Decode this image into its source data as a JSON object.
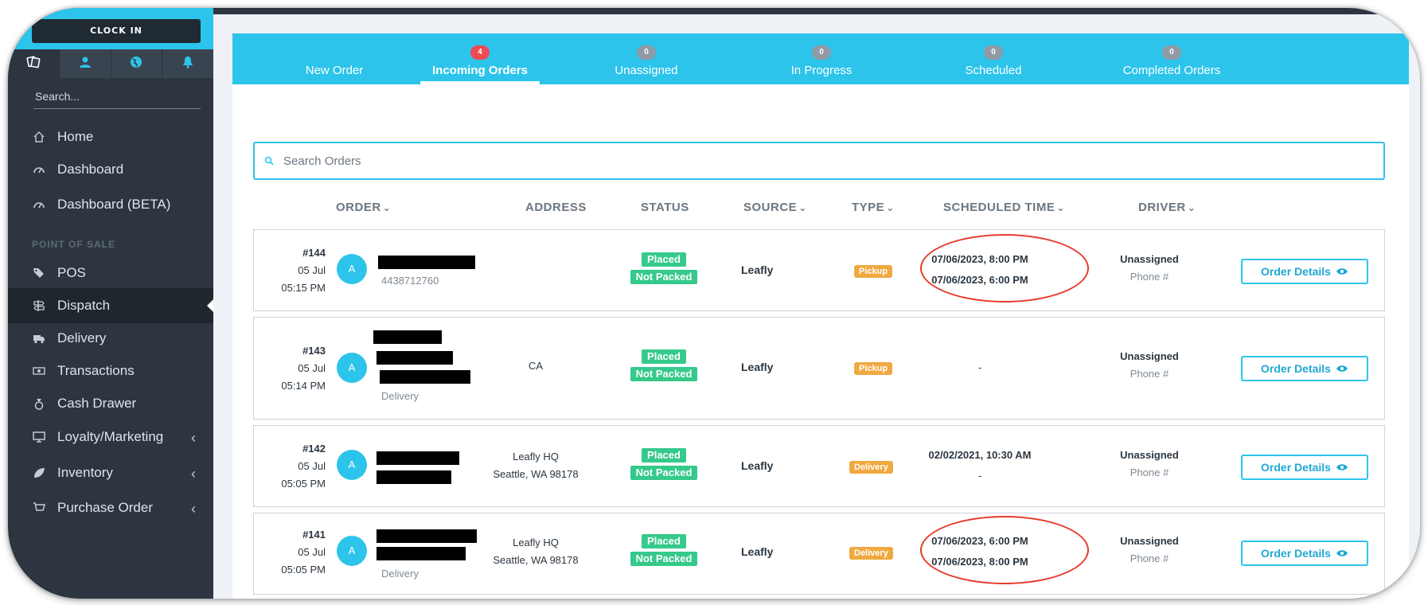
{
  "sidebar": {
    "clock_in": "CLOCK IN",
    "search_placeholder": "Search...",
    "items": [
      {
        "label": "Home",
        "icon": "home-icon"
      },
      {
        "label": "Dashboard",
        "icon": "gauge-icon"
      },
      {
        "label": "Dashboard (BETA)",
        "icon": "gauge-icon"
      },
      {
        "label": "POS",
        "icon": "tags-icon"
      },
      {
        "label": "Dispatch",
        "icon": "signpost-icon"
      },
      {
        "label": "Delivery",
        "icon": "truck-icon"
      },
      {
        "label": "Transactions",
        "icon": "money-icon"
      },
      {
        "label": "Cash Drawer",
        "icon": "moneybag-icon"
      },
      {
        "label": "Loyalty/Marketing",
        "icon": "monitor-icon"
      },
      {
        "label": "Inventory",
        "icon": "leaf-icon"
      },
      {
        "label": "Purchase Order",
        "icon": "cart-icon"
      }
    ],
    "section_pos": "POINT OF SALE"
  },
  "tabs": [
    {
      "label": "New Order",
      "badge": ""
    },
    {
      "label": "Incoming Orders",
      "badge": "4"
    },
    {
      "label": "Unassigned",
      "badge": "0"
    },
    {
      "label": "In Progress",
      "badge": "0"
    },
    {
      "label": "Scheduled",
      "badge": "0"
    },
    {
      "label": "Completed Orders",
      "badge": "0"
    }
  ],
  "search": {
    "placeholder": "Search Orders"
  },
  "columns": {
    "order": "ORDER",
    "address": "ADDRESS",
    "status": "STATUS",
    "source": "SOURCE",
    "type": "TYPE",
    "scheduled": "SCHEDULED TIME",
    "driver": "DRIVER"
  },
  "orders": [
    {
      "num": "#144",
      "date": "05 Jul",
      "time": "05:15 PM",
      "avatar": "A",
      "sub": "4438712760",
      "addr1": "",
      "addr2": "",
      "status1": "Placed",
      "status2": "Not Packed",
      "source": "Leafly",
      "type": "Pickup",
      "sched1": "07/06/2023, 8:00 PM",
      "sched2": "07/06/2023, 6:00 PM",
      "driver": "Unassigned",
      "phone": "Phone #",
      "btn": "Order Details"
    },
    {
      "num": "#143",
      "date": "05 Jul",
      "time": "05:14 PM",
      "avatar": "A",
      "sub": "Delivery",
      "addr1": "CA",
      "addr2": "",
      "status1": "Placed",
      "status2": "Not Packed",
      "source": "Leafly",
      "type": "Pickup",
      "sched1": "-",
      "sched2": "",
      "driver": "Unassigned",
      "phone": "Phone #",
      "btn": "Order Details"
    },
    {
      "num": "#142",
      "date": "05 Jul",
      "time": "05:05 PM",
      "avatar": "A",
      "sub": "",
      "addr1": "Leafly HQ",
      "addr2": "Seattle, WA 98178",
      "status1": "Placed",
      "status2": "Not Packed",
      "source": "Leafly",
      "type": "Delivery",
      "sched1": "02/02/2021, 10:30 AM",
      "sched2": "-",
      "driver": "Unassigned",
      "phone": "Phone #",
      "btn": "Order Details"
    },
    {
      "num": "#141",
      "date": "05 Jul",
      "time": "05:05 PM",
      "avatar": "A",
      "sub": "Delivery",
      "addr1": "Leafly HQ",
      "addr2": "Seattle, WA 98178",
      "status1": "Placed",
      "status2": "Not Packed",
      "source": "Leafly",
      "type": "Delivery",
      "sched1": "07/06/2023, 6:00 PM",
      "sched2": "07/06/2023, 8:00 PM",
      "driver": "Unassigned",
      "phone": "Phone #",
      "btn": "Order Details"
    }
  ],
  "colors": {
    "accent": "#2cc4ea",
    "sidebar": "#2c3540",
    "status_green": "#35c98b",
    "type_orange": "#f0a841",
    "badge_red": "#ee4b56",
    "highlight_red": "#e53a28"
  }
}
